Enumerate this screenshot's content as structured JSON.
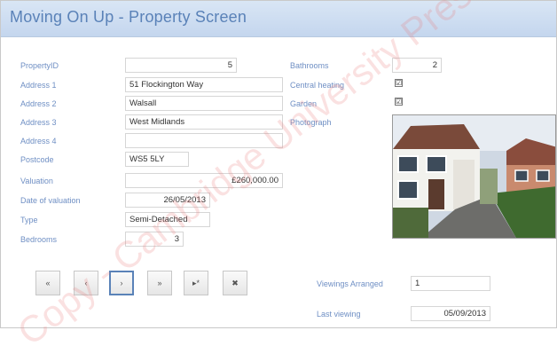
{
  "window": {
    "title": "Moving On Up - Property Screen"
  },
  "fields": [
    {
      "label": "PropertyID",
      "value": "5"
    },
    {
      "label": "Address 1",
      "value": "51 Flockington Way"
    },
    {
      "label": "Address 2",
      "value": "Walsall"
    },
    {
      "label": "Address 3",
      "value": "West Midlands"
    },
    {
      "label": "Address 4",
      "value": ""
    },
    {
      "label": "Postcode",
      "value": "WS5 5LY"
    },
    {
      "label": "Valuation",
      "value": "£260,000.00"
    },
    {
      "label": "Date of valuation",
      "value": "26/05/2013"
    },
    {
      "label": "Type",
      "value": "Semi-Detached"
    },
    {
      "label": "Bedrooms",
      "value": "3"
    }
  ],
  "right_fields": {
    "bathrooms_label": "Bathrooms",
    "bathrooms_value": "2",
    "central_heating_label": "Central heating",
    "central_heating_checked": "☑",
    "garden_label": "Garden",
    "garden_checked": "☑",
    "photograph_label": "Photograph"
  },
  "navigation": {
    "buttons": [
      {
        "name": "first-record",
        "glyph": "«"
      },
      {
        "name": "previous-record",
        "glyph": "‹"
      },
      {
        "name": "next-record",
        "glyph": "›"
      },
      {
        "name": "last-record",
        "glyph": "»"
      },
      {
        "name": "new-record",
        "glyph": "▸*"
      },
      {
        "name": "delete-record",
        "glyph": "✖"
      }
    ]
  },
  "bottom_fields": {
    "viewings_label": "Viewings Arranged",
    "viewings_value": "1",
    "last_viewing_label": "Last viewing",
    "last_viewing_value": "05/09/2013"
  },
  "watermark": {
    "text": "Copy - Cambridge University Press"
  },
  "colors": {
    "header": "#c4d6ee",
    "title": "#5a82b8",
    "label": "#6f8fc4"
  }
}
